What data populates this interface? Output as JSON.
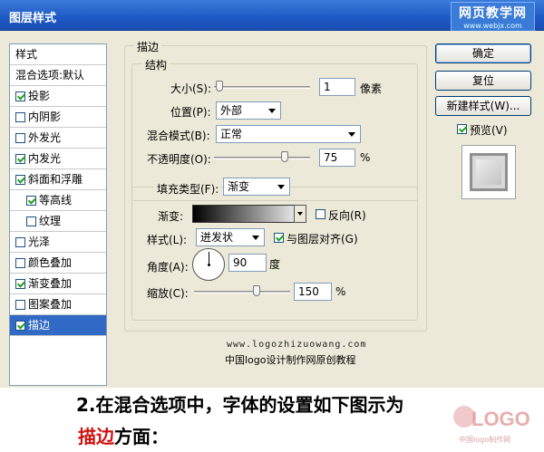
{
  "window": {
    "title": "图层样式",
    "watermark_cn": "网页教学网",
    "watermark_url": "www.webjx.com"
  },
  "sidebar": {
    "items": [
      {
        "label": "样式",
        "checkbox": false,
        "checked": false,
        "indent": false,
        "selected": false
      },
      {
        "label": "混合选项:默认",
        "checkbox": false,
        "checked": false,
        "indent": false,
        "selected": false
      },
      {
        "label": "投影",
        "checkbox": true,
        "checked": true,
        "indent": false,
        "selected": false
      },
      {
        "label": "内阴影",
        "checkbox": true,
        "checked": false,
        "indent": false,
        "selected": false
      },
      {
        "label": "外发光",
        "checkbox": true,
        "checked": false,
        "indent": false,
        "selected": false
      },
      {
        "label": "内发光",
        "checkbox": true,
        "checked": true,
        "indent": false,
        "selected": false
      },
      {
        "label": "斜面和浮雕",
        "checkbox": true,
        "checked": true,
        "indent": false,
        "selected": false
      },
      {
        "label": "等高线",
        "checkbox": true,
        "checked": true,
        "indent": true,
        "selected": false
      },
      {
        "label": "纹理",
        "checkbox": true,
        "checked": false,
        "indent": true,
        "selected": false
      },
      {
        "label": "光泽",
        "checkbox": true,
        "checked": false,
        "indent": false,
        "selected": false
      },
      {
        "label": "颜色叠加",
        "checkbox": true,
        "checked": false,
        "indent": false,
        "selected": false
      },
      {
        "label": "渐变叠加",
        "checkbox": true,
        "checked": true,
        "indent": false,
        "selected": false
      },
      {
        "label": "图案叠加",
        "checkbox": true,
        "checked": false,
        "indent": false,
        "selected": false
      },
      {
        "label": "描边",
        "checkbox": true,
        "checked": true,
        "indent": false,
        "selected": true
      }
    ]
  },
  "stroke": {
    "group_title": "描边",
    "structure": {
      "title": "结构",
      "size_label": "大小(S):",
      "size_value": "1",
      "size_unit": "像素",
      "size_level": 0.02,
      "position_label": "位置(P):",
      "position_value": "外部",
      "blend_label": "混合模式(B):",
      "blend_value": "正常",
      "opacity_label": "不透明度(O):",
      "opacity_value": "75",
      "opacity_unit": "%",
      "opacity_level": 0.75
    },
    "fill": {
      "type_label": "填充类型(F):",
      "type_value": "渐变",
      "gradient_label": "渐变:",
      "reverse_label": "反向(R)",
      "reverse_checked": false,
      "style_label": "样式(L):",
      "style_value": "迸发状",
      "align_label": "与图层对齐(G)",
      "align_checked": true,
      "angle_label": "角度(A):",
      "angle_value": "90",
      "angle_unit": "度",
      "scale_label": "缩放(C):",
      "scale_value": "150",
      "scale_unit": "%",
      "scale_level": 0.66
    }
  },
  "buttons": {
    "ok": "确定",
    "reset": "复位",
    "new_style": "新建样式(W)...",
    "preview_label": "预览(V)",
    "preview_checked": true
  },
  "overlay": {
    "site_url": "www.logozhizuowang.com",
    "site_caption": "中国logo设计制作网原创教程"
  },
  "caption": {
    "line1": "2.在混合选项中，字体的设置如下图示为",
    "line2_highlight": "描边",
    "line2_rest": "方面：",
    "logo_text": "LOGO",
    "logo_sub": "中国logo制作网"
  }
}
